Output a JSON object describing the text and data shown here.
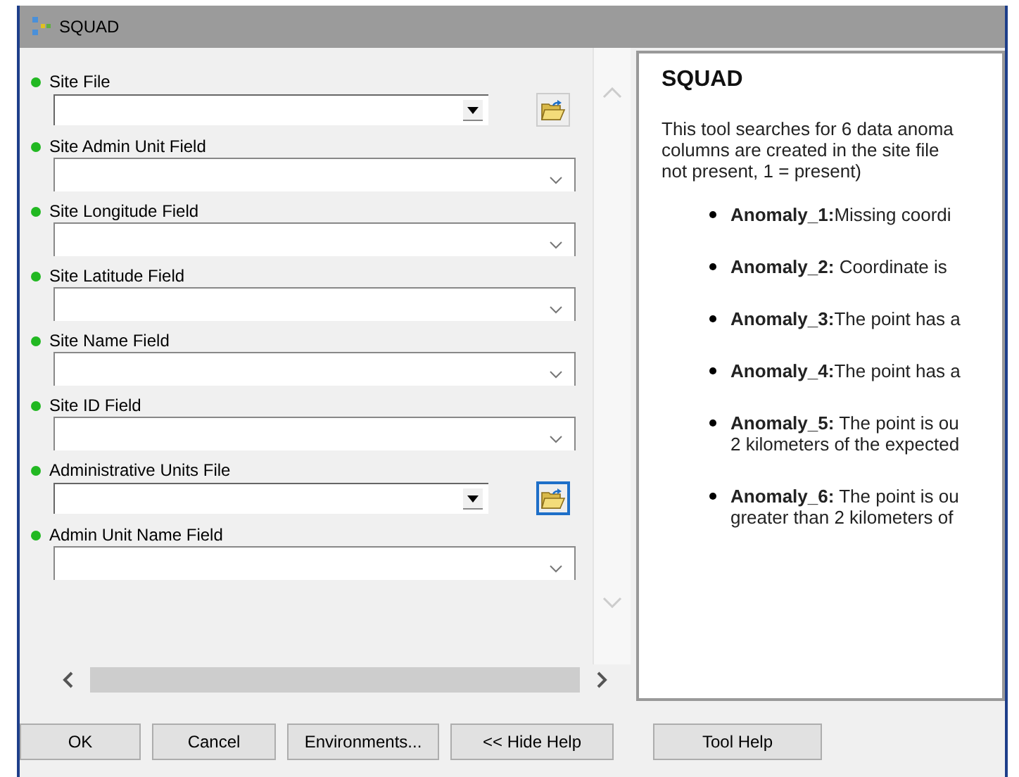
{
  "window": {
    "title": "SQUAD"
  },
  "parameters": [
    {
      "label": "Site File",
      "kind": "file",
      "focused": false
    },
    {
      "label": "Site Admin Unit Field",
      "kind": "field"
    },
    {
      "label": "Site Longitude Field",
      "kind": "field"
    },
    {
      "label": "Site Latitude Field",
      "kind": "field"
    },
    {
      "label": "Site Name Field",
      "kind": "field"
    },
    {
      "label": "Site ID Field",
      "kind": "field"
    },
    {
      "label": "Administrative Units File",
      "kind": "file",
      "focused": true
    },
    {
      "label": "Admin Unit Name Field",
      "kind": "field"
    }
  ],
  "help": {
    "title": "SQUAD",
    "intro": [
      "This tool searches for 6 data anoma",
      "columns are created in the site file",
      "not present, 1 = present)"
    ],
    "anomalies": [
      {
        "lines": [
          "**Anomaly_1:**Missing coordi"
        ]
      },
      {
        "lines": [
          "**Anomaly_2:** Coordinate is"
        ]
      },
      {
        "lines": [
          "**Anomaly_3:**The point has a"
        ]
      },
      {
        "lines": [
          "**Anomaly_4:**The point has a"
        ]
      },
      {
        "lines": [
          "**Anomaly_5:** The point is ou",
          "2 kilometers of the expected"
        ]
      },
      {
        "lines": [
          "**Anomaly_6:** The point is ou",
          "greater than 2 kilometers of"
        ]
      }
    ]
  },
  "buttons": [
    "OK",
    "Cancel",
    "Environments...",
    "<< Hide Help"
  ],
  "help_button": "Tool Help"
}
